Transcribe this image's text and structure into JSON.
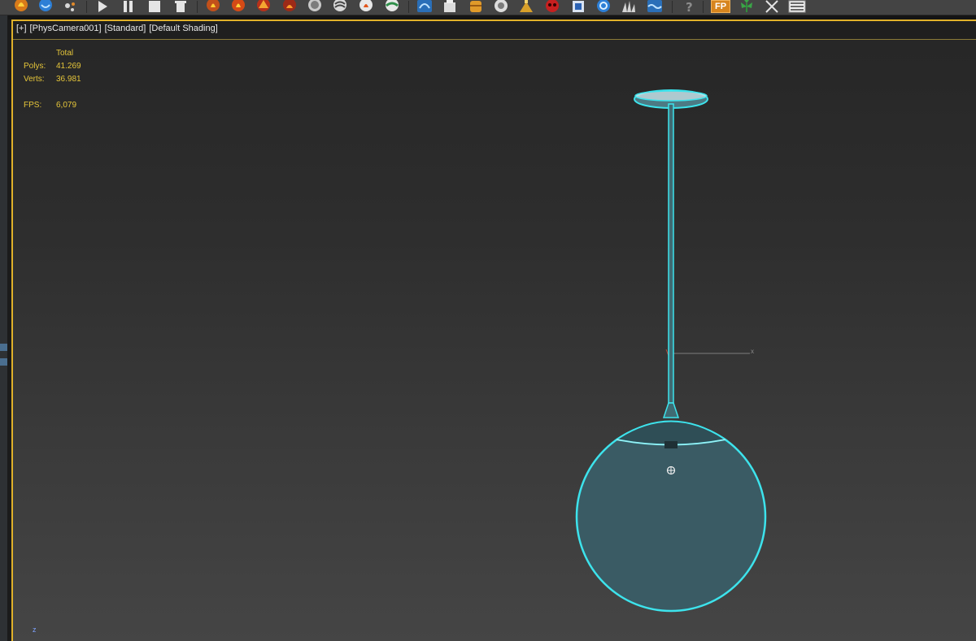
{
  "toolbar": {
    "icons": [
      "fire-icon",
      "water-drop-icon",
      "particles-icon",
      "play-icon",
      "pause-icon",
      "stop-icon",
      "reset-icon",
      "fire-sim-icon",
      "fire-sim-icon",
      "fire-burst-icon",
      "fire-emitter-icon",
      "smoke-icon",
      "wind-icon",
      "explosion-icon",
      "gear-fluid-icon",
      "liquid-splash-icon",
      "bucket-icon",
      "barrel-icon",
      "cup-icon",
      "fountain-icon",
      "mask-icon",
      "cube-icon",
      "swirl-icon",
      "grass-icon",
      "ocean-icon",
      "help-icon",
      "fp-icon",
      "plant-icon",
      "close-cross-icon",
      "list-icon"
    ],
    "fp_label": "FP"
  },
  "viewport": {
    "label": {
      "view_type": "[+]",
      "camera": "[PhysCamera001]",
      "visual_style": "[Standard]",
      "shading": "[Default Shading]"
    },
    "stats": {
      "header": "Total",
      "polys_label": "Polys:",
      "polys_value": "41.269",
      "verts_label": "Verts:",
      "verts_value": "36.981",
      "fps_label": "FPS:",
      "fps_value": "6,079"
    },
    "axis": {
      "x_label": "x",
      "z_label": "z"
    }
  },
  "colors": {
    "selection": "#3de3ec",
    "viewport_border": "#e0b12a",
    "stats_text": "#e6c63a"
  }
}
